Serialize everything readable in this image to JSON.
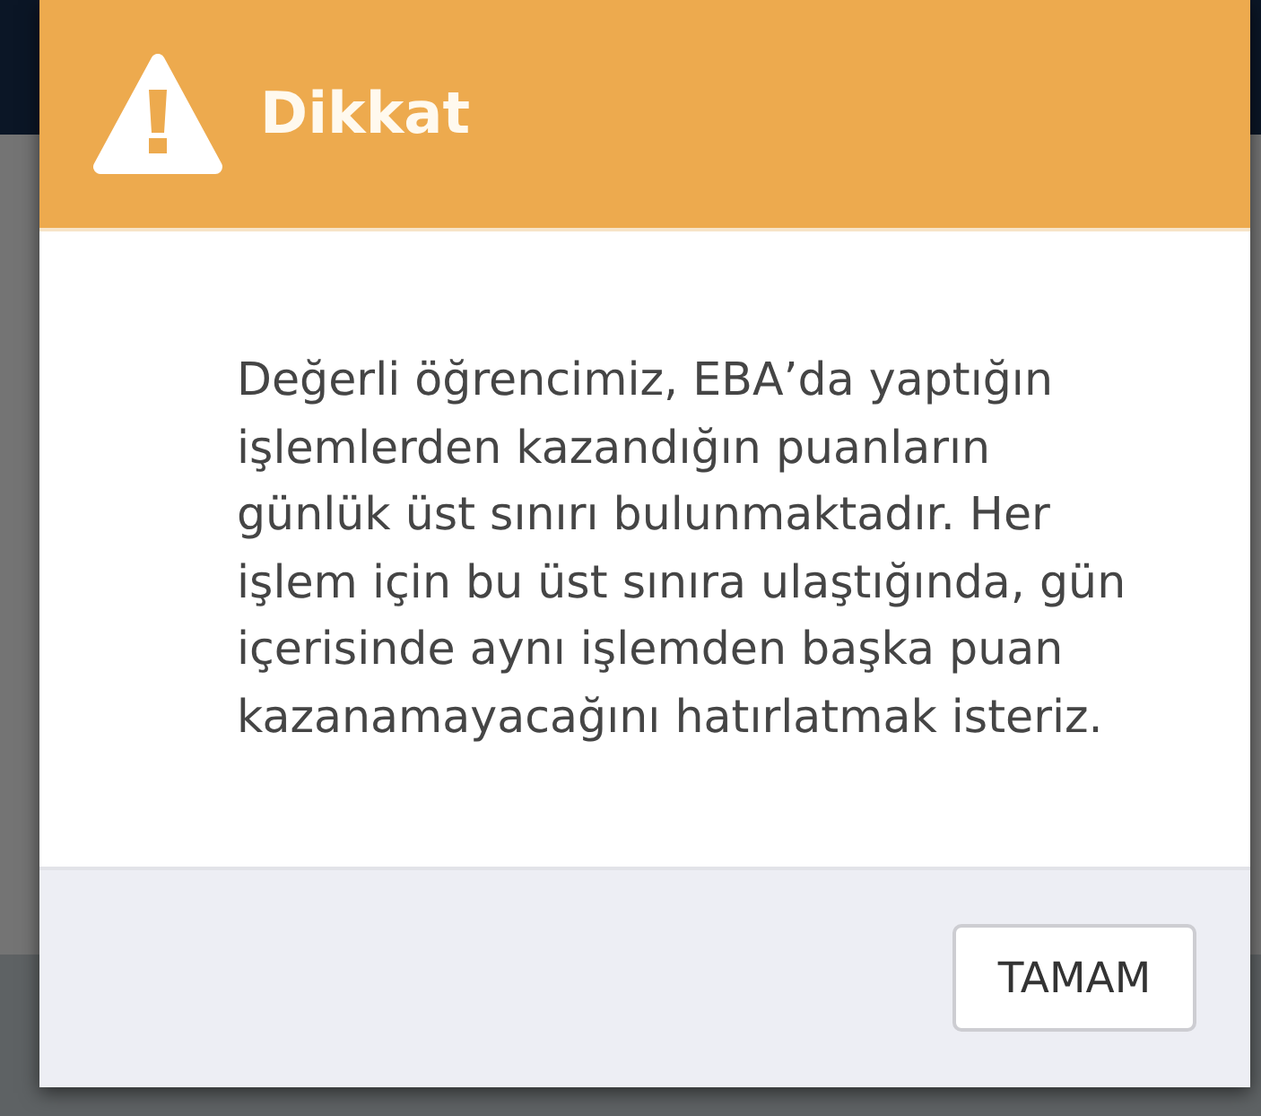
{
  "dialog": {
    "title": "Dikkat",
    "message": "Değerli öğrencimiz, EBA’da yaptığın işlemlerden kazandığın puanların günlük üst sınırı bulunmaktadır. Her işlem için bu üst sınıra ulaştığında, gün içerisinde aynı işlemden başka puan kazanamayacağını hatırlatmak isteriz.",
    "buttons": [
      {
        "label": "TAMAM"
      }
    ]
  }
}
